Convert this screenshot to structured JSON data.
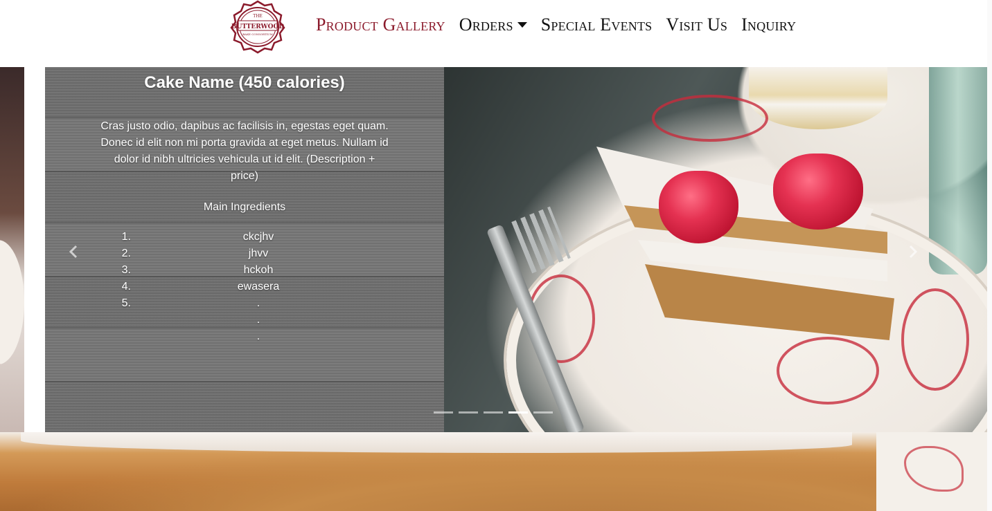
{
  "brand": {
    "logo_text_top": "THE",
    "logo_text_main": "BUTTERWOOD",
    "logo_text_bottom": "BAKE CONSORTIUM"
  },
  "nav": {
    "items": [
      {
        "label": "Product Gallery",
        "active": true
      },
      {
        "label": "Orders",
        "dropdown": true
      },
      {
        "label": "Special Events"
      },
      {
        "label": "Visit Us"
      },
      {
        "label": "Inquiry"
      }
    ]
  },
  "carousel": {
    "caption": {
      "title": "Cake Name (450 calories)",
      "description": "Cras justo odio, dapibus ac facilisis in, egestas eget quam. Donec id elit non mi porta gravida at eget metus. Nullam id dolor id nibh ultricies vehicula ut id elit. (Description + price)",
      "ingredients_heading": "Main Ingredients",
      "ingredients": [
        {
          "num": "1.",
          "value": "ckcjhv"
        },
        {
          "num": "2.",
          "value": "jhvv"
        },
        {
          "num": "3.",
          "value": "hckoh"
        },
        {
          "num": "4.",
          "value": "ewasera"
        },
        {
          "num": "5.",
          "value": "."
        },
        {
          "num": "",
          "value": "."
        },
        {
          "num": "",
          "value": "."
        }
      ]
    },
    "indicators": {
      "count": 5,
      "active_index": 3
    },
    "controls": {
      "prev_icon": "chevron-left-icon",
      "next_icon": "chevron-right-icon"
    }
  },
  "colors": {
    "brand_red": "#8b1a2b",
    "nav_text": "#111111"
  }
}
